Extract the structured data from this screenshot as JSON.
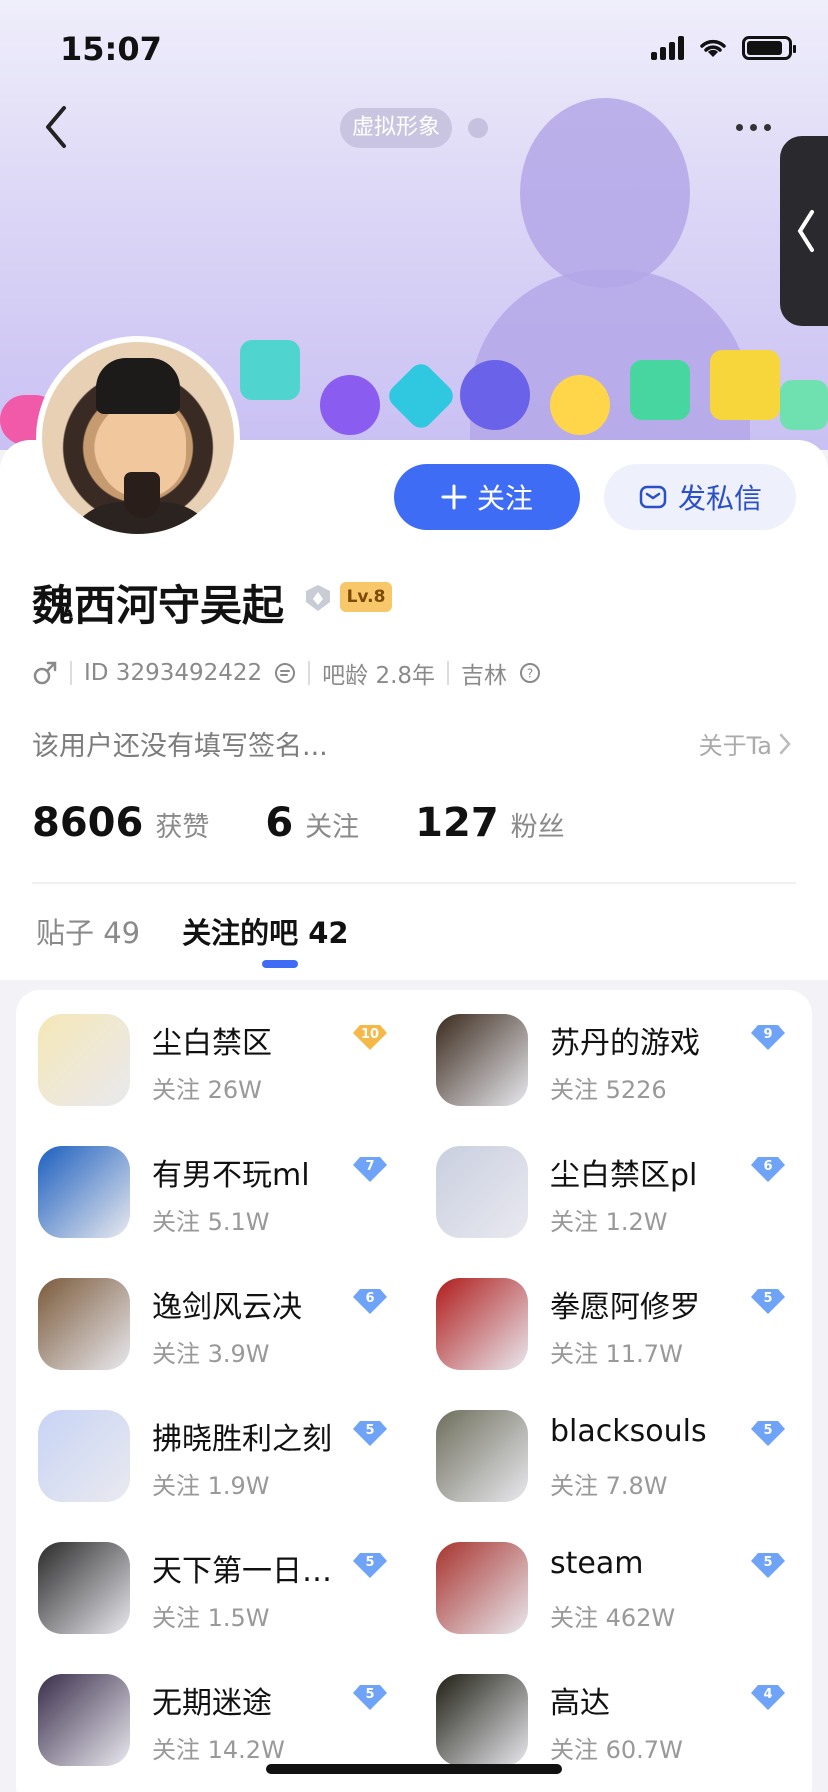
{
  "status_bar": {
    "time": "15:07"
  },
  "header": {
    "avatar_tag": "虚拟形象"
  },
  "profile": {
    "username": "魏西河守吴起",
    "level": "Lv.8",
    "gender_icon": "male-icon",
    "id_text": "ID 3293492422",
    "bar_age": "吧龄 2.8年",
    "location": "吉林",
    "bio": "该用户还没有填写签名...",
    "about_link": "关于Ta",
    "follow_button": "关注",
    "message_button": "发私信"
  },
  "stats": [
    {
      "value": "8606",
      "label": "获赞"
    },
    {
      "value": "6",
      "label": "关注"
    },
    {
      "value": "127",
      "label": "粉丝"
    }
  ],
  "tabs": [
    {
      "label": "贴子 49"
    },
    {
      "label": "关注的吧 42"
    }
  ],
  "forums": [
    {
      "name": "尘白禁区",
      "followers": "关注 26W",
      "level": "10",
      "level_color": "#f5b94a",
      "icon_color": "#f5e7b6"
    },
    {
      "name": "苏丹的游戏",
      "followers": "关注 5226",
      "level": "9",
      "level_color": "#6fa3f7",
      "icon_color": "#3a2a1c"
    },
    {
      "name": "有男不玩ml",
      "followers": "关注 5.1W",
      "level": "7",
      "level_color": "#6fa3f7",
      "icon_color": "#1c5fbf"
    },
    {
      "name": "尘白禁区pl",
      "followers": "关注 1.2W",
      "level": "6",
      "level_color": "#6fa3f7",
      "icon_color": "#c9cfe0"
    },
    {
      "name": "逸剑风云决",
      "followers": "关注 3.9W",
      "level": "6",
      "level_color": "#6fa3f7",
      "icon_color": "#7b5a3a"
    },
    {
      "name": "拳愿阿修罗",
      "followers": "关注 11.7W",
      "level": "5",
      "level_color": "#6fa3f7",
      "icon_color": "#b01c1c"
    },
    {
      "name": "拂晓胜利之刻",
      "followers": "关注 1.9W",
      "level": "5",
      "level_color": "#6fa3f7",
      "icon_color": "#c8d4f5"
    },
    {
      "name": "blacksouls",
      "followers": "关注 7.8W",
      "level": "5",
      "level_color": "#6fa3f7",
      "icon_color": "#6e6e5c"
    },
    {
      "name": "天下第一日…",
      "followers": "关注 1.5W",
      "level": "5",
      "level_color": "#6fa3f7",
      "icon_color": "#2a2a2a"
    },
    {
      "name": "steam",
      "followers": "关注 462W",
      "level": "5",
      "level_color": "#6fa3f7",
      "icon_color": "#a8332e"
    },
    {
      "name": "无期迷途",
      "followers": "关注 14.2W",
      "level": "5",
      "level_color": "#6fa3f7",
      "icon_color": "#3a2d4a"
    },
    {
      "name": "高达",
      "followers": "关注 60.7W",
      "level": "4",
      "level_color": "#6fa3f7",
      "icon_color": "#1f1f14"
    }
  ],
  "colors": {
    "accent": "#3f6cf4",
    "level_badge": "#f7c76a"
  }
}
